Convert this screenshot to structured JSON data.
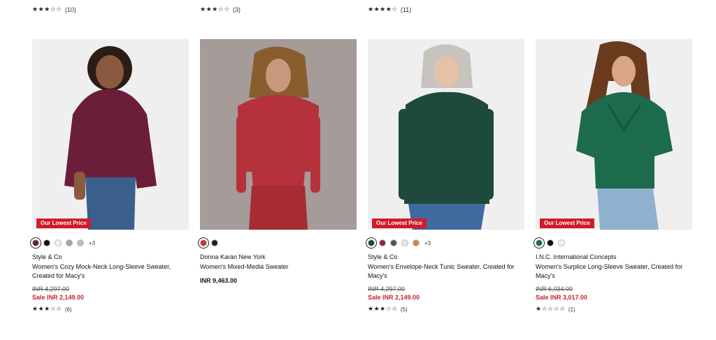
{
  "colors": {
    "badge_bg": "#d21a2b",
    "sale_red": "#c91f2f"
  },
  "top_ratings": [
    {
      "stars": "★★★☆☆",
      "count": "(10)"
    },
    {
      "stars": "★★★☆☆",
      "count": "(3)"
    },
    {
      "stars": "★★★★☆",
      "count": "(11)"
    }
  ],
  "products": [
    {
      "badge": "Our Lowest Price",
      "swatches": [
        "#6b1e3a",
        "#111111",
        "#f1f1f1",
        "#9da4ad",
        "#cdbba4"
      ],
      "more_colors": "+3",
      "brand": "Style & Co",
      "title": "Women's Cozy Mock-Neck Long-Sleeve Sweater, Created for Macy's",
      "original_price": "INR 4,297.00",
      "sale_price": "Sale INR 2,149.00",
      "rating_stars": "★★★☆☆",
      "rating_count": "(6)"
    },
    {
      "badge": "",
      "swatches": [
        "#c8313d",
        "#2a1e19"
      ],
      "more_colors": "",
      "brand": "Donna Karan New York",
      "title": "Women's Mixed-Media Sweater",
      "price": "INR 9,463.00"
    },
    {
      "badge": "Our Lowest Price",
      "swatches": [
        "#1d4a3b",
        "#862a3f",
        "#4b5560",
        "#e6e6e6",
        "#c78a4c"
      ],
      "more_colors": "+3",
      "brand": "Style & Co",
      "title": "Women's Envelope-Neck Tunic Sweater, Created for Macy's",
      "original_price": "INR 4,297.00",
      "sale_price": "Sale INR 2,149.00",
      "rating_stars": "★★★☆☆",
      "rating_count": "(5)"
    },
    {
      "badge": "Our Lowest Price",
      "swatches": [
        "#1c6b4c",
        "#111111",
        "#f1f1f1"
      ],
      "more_colors": "",
      "brand": "I.N.C. International Concepts",
      "title": "Women's Surplice Long-Sleeve Sweater, Created for Macy's",
      "original_price": "INR 6,034.00",
      "sale_price": "Sale INR 3,017.00",
      "rating_stars": "★☆☆☆☆",
      "rating_count": "(1)"
    }
  ]
}
